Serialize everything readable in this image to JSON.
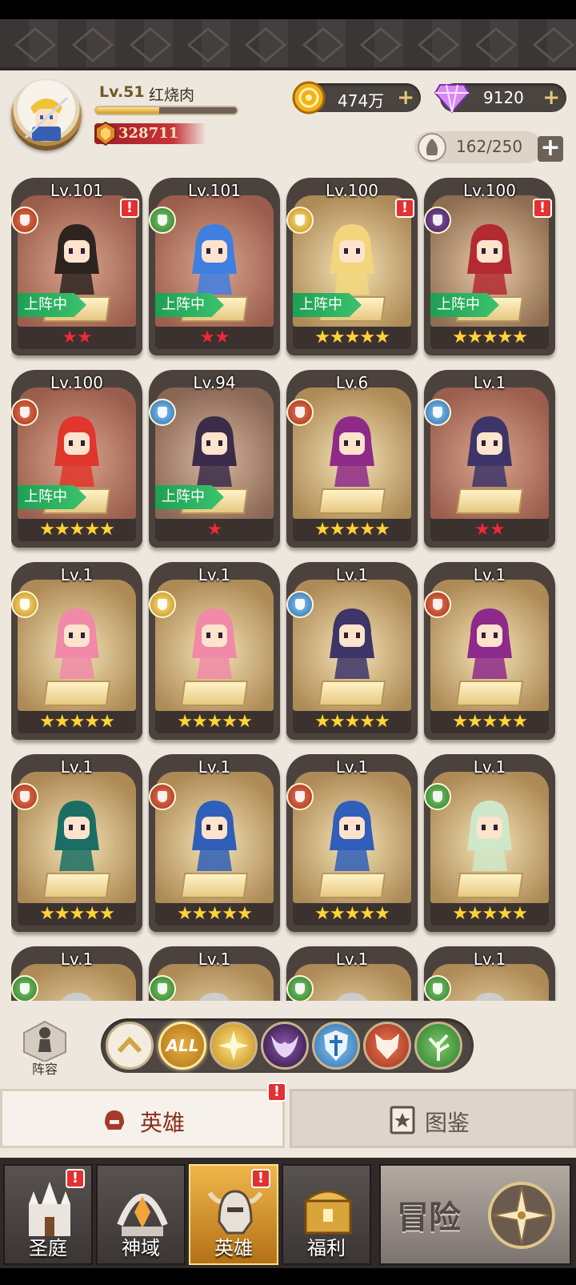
{
  "player": {
    "level": "Lv.51",
    "name": "红烧肉",
    "xp_fraction": 0.45,
    "power": "328711"
  },
  "currency": {
    "gold": "474万",
    "gems": "9120",
    "plus": "+"
  },
  "hero_capacity": "162/250",
  "capacity_plus": "+",
  "alert_mark": "!",
  "deployed_label": "上阵中",
  "heroes": [
    {
      "level": "Lv.101",
      "faction": "fox",
      "stars": "★★",
      "star_color": "red",
      "deployed": true,
      "alert": true,
      "bg": "red",
      "color": "#2d2420"
    },
    {
      "level": "Lv.101",
      "faction": "tree",
      "stars": "★★",
      "star_color": "red",
      "deployed": true,
      "alert": false,
      "bg": "red",
      "color": "#3f7fe0"
    },
    {
      "level": "Lv.100",
      "faction": "sun",
      "stars": "★★★★★",
      "star_color": "gold",
      "deployed": true,
      "alert": true,
      "bg": "gold",
      "color": "#f3d67c"
    },
    {
      "level": "Lv.100",
      "faction": "dark",
      "stars": "★★★★★",
      "star_color": "gold",
      "deployed": true,
      "alert": true,
      "bg": "brown",
      "color": "#b32a32"
    },
    {
      "level": "Lv.100",
      "faction": "fox",
      "stars": "★★★★★",
      "star_color": "gold",
      "deployed": true,
      "alert": false,
      "bg": "red",
      "color": "#e0362c"
    },
    {
      "level": "Lv.94",
      "faction": "shield",
      "stars": "★",
      "star_color": "red",
      "deployed": true,
      "alert": false,
      "bg": "blue",
      "color": "#3b2c4a"
    },
    {
      "level": "Lv.6",
      "faction": "fox",
      "stars": "★★★★★",
      "star_color": "gold",
      "deployed": false,
      "alert": false,
      "bg": "gold",
      "color": "#8e2a8a"
    },
    {
      "level": "Lv.1",
      "faction": "shield",
      "stars": "★★",
      "star_color": "red",
      "deployed": false,
      "alert": false,
      "bg": "red",
      "color": "#3d3568"
    },
    {
      "level": "Lv.1",
      "faction": "sun",
      "stars": "★★★★★",
      "star_color": "gold",
      "deployed": false,
      "alert": false,
      "bg": "gold",
      "color": "#f08aa8"
    },
    {
      "level": "Lv.1",
      "faction": "sun",
      "stars": "★★★★★",
      "star_color": "gold",
      "deployed": false,
      "alert": false,
      "bg": "gold",
      "color": "#f08aa8"
    },
    {
      "level": "Lv.1",
      "faction": "shield",
      "stars": "★★★★★",
      "star_color": "gold",
      "deployed": false,
      "alert": false,
      "bg": "gold",
      "color": "#3d3568"
    },
    {
      "level": "Lv.1",
      "faction": "fox",
      "stars": "★★★★★",
      "star_color": "gold",
      "deployed": false,
      "alert": false,
      "bg": "gold",
      "color": "#8e2a8a"
    },
    {
      "level": "Lv.1",
      "faction": "fox",
      "stars": "★★★★★",
      "star_color": "gold",
      "deployed": false,
      "alert": false,
      "bg": "gold",
      "color": "#1b6e63"
    },
    {
      "level": "Lv.1",
      "faction": "fox",
      "stars": "★★★★★",
      "star_color": "gold",
      "deployed": false,
      "alert": false,
      "bg": "gold",
      "color": "#2f5fb8"
    },
    {
      "level": "Lv.1",
      "faction": "fox",
      "stars": "★★★★★",
      "star_color": "gold",
      "deployed": false,
      "alert": false,
      "bg": "gold",
      "color": "#2f5fb8"
    },
    {
      "level": "Lv.1",
      "faction": "tree",
      "stars": "★★★★★",
      "star_color": "gold",
      "deployed": false,
      "alert": false,
      "bg": "gold",
      "color": "#cfe7c9"
    },
    {
      "level": "Lv.1",
      "faction": "tree",
      "stars": "",
      "star_color": "gold",
      "deployed": false,
      "alert": false,
      "bg": "gold",
      "color": "#cccccc"
    },
    {
      "level": "Lv.1",
      "faction": "tree",
      "stars": "",
      "star_color": "gold",
      "deployed": false,
      "alert": false,
      "bg": "gold",
      "color": "#cccccc"
    },
    {
      "level": "Lv.1",
      "faction": "tree",
      "stars": "",
      "star_color": "gold",
      "deployed": false,
      "alert": false,
      "bg": "gold",
      "color": "#cccccc"
    },
    {
      "level": "Lv.1",
      "faction": "tree",
      "stars": "",
      "star_color": "gold",
      "deployed": false,
      "alert": false,
      "bg": "gold",
      "color": "#cccccc"
    }
  ],
  "lineup_label": "阵容",
  "filters": [
    {
      "name": "collapse",
      "label": ""
    },
    {
      "name": "all",
      "label": "ALL"
    },
    {
      "name": "light",
      "label": ""
    },
    {
      "name": "dark",
      "label": ""
    },
    {
      "name": "shield",
      "label": ""
    },
    {
      "name": "fox",
      "label": ""
    },
    {
      "name": "tree",
      "label": ""
    }
  ],
  "tabs": {
    "heroes": "英雄",
    "codex": "图鉴"
  },
  "nav": {
    "court": "圣庭",
    "domain": "神域",
    "heroes": "英雄",
    "welfare": "福利",
    "adventure": "冒险"
  },
  "colors": {
    "accent_gold": "#e7b047",
    "alert_red": "#e33030",
    "deploy_green": "#1f9f54"
  }
}
